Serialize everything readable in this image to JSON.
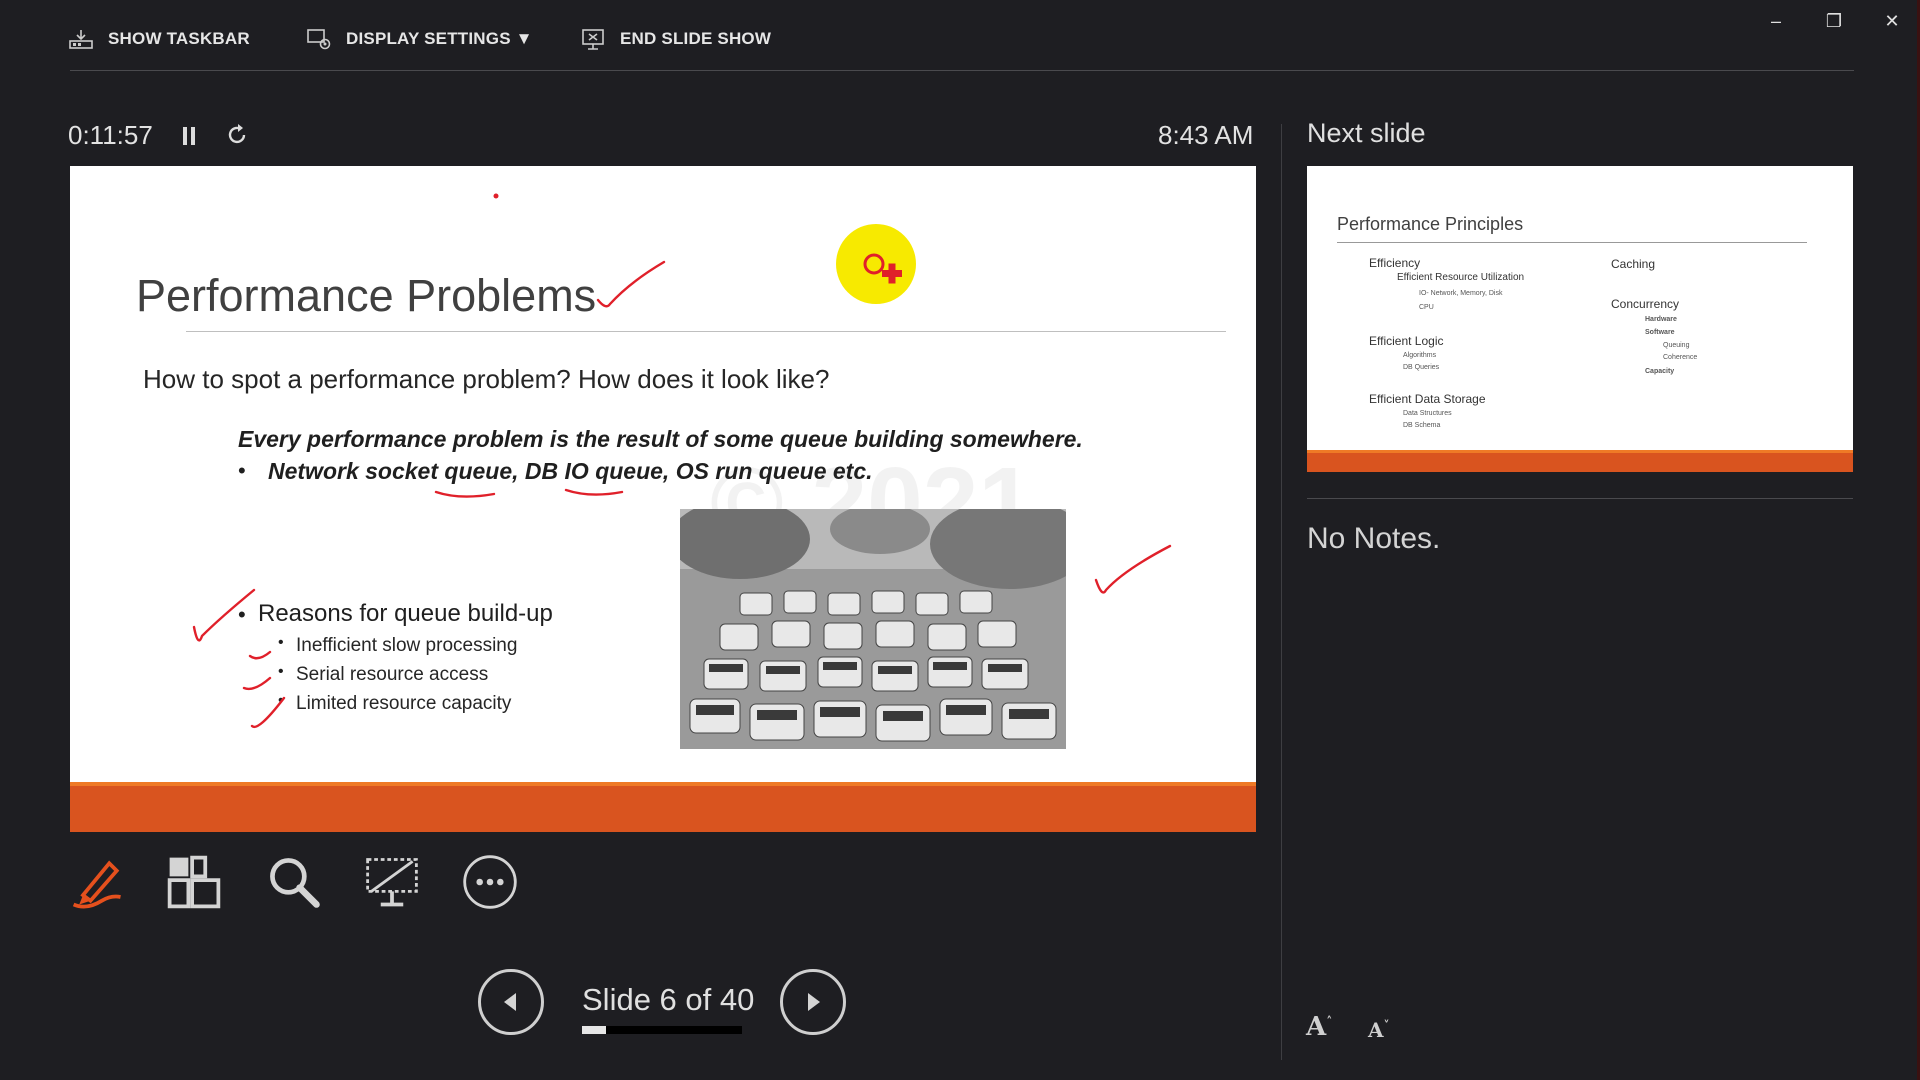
{
  "toolbar": {
    "show_taskbar": "SHOW TASKBAR",
    "display_settings": "DISPLAY SETTINGS ▼",
    "end_slide_show": "END SLIDE SHOW"
  },
  "window_controls": {
    "minimize": "–",
    "restore": "❐",
    "close": "✕"
  },
  "status": {
    "elapsed": "0:11:57",
    "pause_icon": "pause-icon",
    "reset_icon": "reset-timer-icon",
    "clock": "8:43 AM"
  },
  "current_slide": {
    "title": "Performance Problems",
    "question": "How to spot a performance problem? How does it look like?",
    "statement": "Every performance problem is the result of some queue building somewhere.",
    "queue_examples": "Network socket queue, DB IO queue, OS run queue etc.",
    "reasons_heading": "Reasons for queue build-up",
    "reasons": [
      "Inefficient slow processing",
      "Serial resource access",
      "Limited resource capacity"
    ],
    "watermark": "© 2021",
    "image_alt": "traffic-jam-photo",
    "accent_color": "#d9541f",
    "annotation_color": "#e0202a"
  },
  "next_slide": {
    "label": "Next slide",
    "title": "Performance Principles",
    "left_col": {
      "efficiency": "Efficiency",
      "eru": "Efficient Resource Utilization",
      "io": "IO- Network, Memory, Disk",
      "cpu": "CPU",
      "logic": "Efficient Logic",
      "algorithms": "Algorithms",
      "db_queries": "DB Queries",
      "storage": "Efficient Data Storage",
      "data_structures": "Data Structures",
      "db_schema": "DB Schema"
    },
    "right_col": {
      "caching": "Caching",
      "concurrency": "Concurrency",
      "hardware": "Hardware",
      "software": "Software",
      "queuing": "Queuing",
      "coherence": "Coherence",
      "capacity": "Capacity"
    }
  },
  "notes": {
    "text": "No Notes."
  },
  "navigation": {
    "slide_count": "Slide 6 of 40",
    "progress_fraction": 0.15
  },
  "font_controls": {
    "increase": "A",
    "decrease": "A"
  }
}
